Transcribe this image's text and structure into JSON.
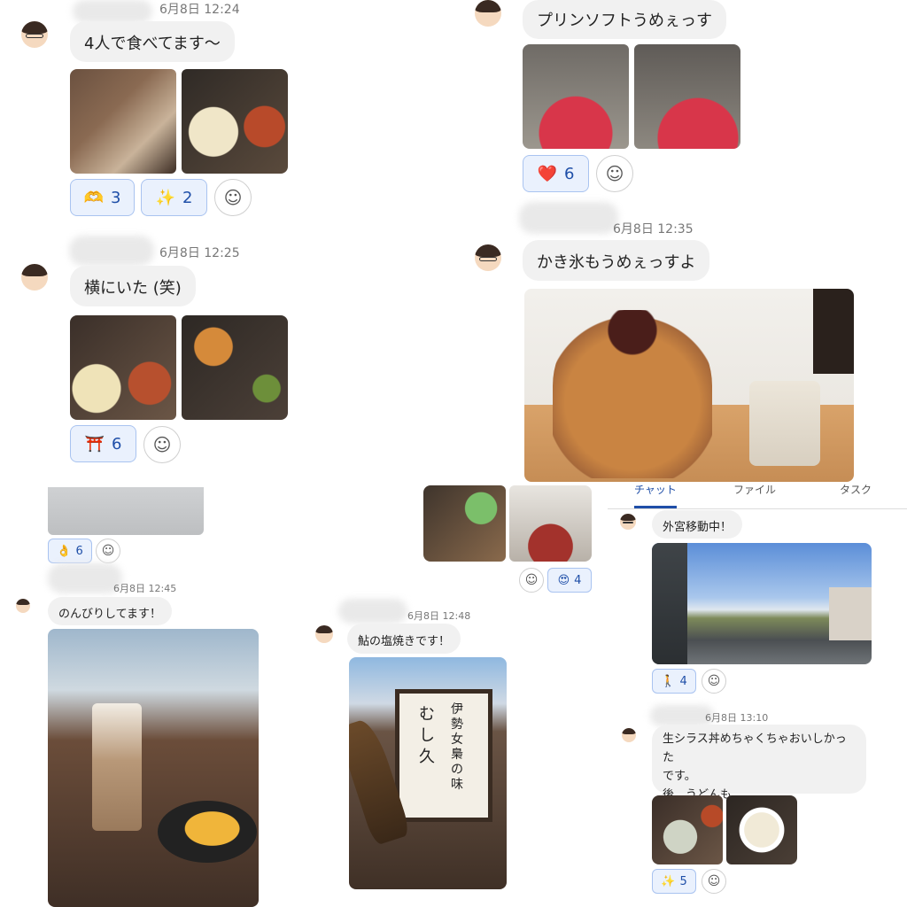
{
  "messages": [
    {
      "time": "6月8日 12:24",
      "text": "4人で食べてます〜",
      "reactions": [
        {
          "emoji": "🫶",
          "count": "3"
        },
        {
          "emoji": "✨",
          "count": "2"
        }
      ]
    },
    {
      "time": "6月8日 12:25",
      "text": "横にいた (笑)",
      "reactions": [
        {
          "emoji": "⛩️",
          "count": "6"
        }
      ]
    },
    {
      "text": "プリンソフトうめぇっす",
      "reactions": [
        {
          "emoji": "❤️",
          "count": "6"
        }
      ]
    },
    {
      "time": "6月8日 12:35",
      "text": "かき氷もうめぇっすよ"
    },
    {
      "reactions": [
        {
          "emoji": "👌",
          "count": "6"
        }
      ]
    },
    {
      "reactions": [
        {
          "emoji": "😍",
          "count": "4"
        }
      ]
    },
    {
      "time": "6月8日 12:45",
      "text": "のんびりしてます！"
    },
    {
      "time": "6月8日 12:48",
      "text": "鮎の塩焼きです！"
    },
    {
      "text": "外宮移動中！",
      "reactions": [
        {
          "emoji": "🚶",
          "count": "4"
        }
      ]
    },
    {
      "time": "6月8日 13:10",
      "lines": [
        "生シラス丼めちゃくちゃおいしかった",
        "です。",
        "後、うどんも"
      ],
      "reactions": [
        {
          "emoji": "✨",
          "count": "5"
        }
      ]
    }
  ],
  "tabs": {
    "chat": "チャット",
    "files": "ファイル",
    "tasks": "タスク"
  },
  "signs": {
    "ise": "伊勢女梟の味",
    "sign_small": "むし久"
  },
  "colors": {
    "accent": "#1f4fa8",
    "reaction_bg": "#eaf1fd",
    "bubble": "#f1f1f1"
  }
}
